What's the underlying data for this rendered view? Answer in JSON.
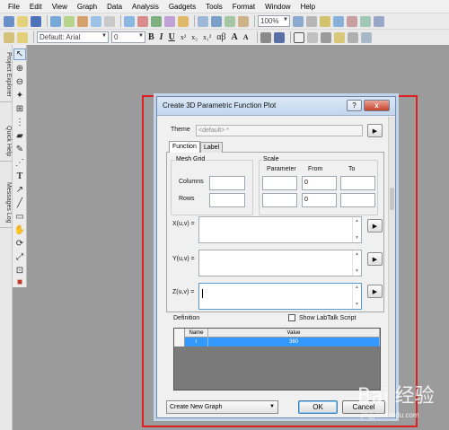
{
  "menu": [
    "File",
    "Edit",
    "View",
    "Graph",
    "Data",
    "Analysis",
    "Gadgets",
    "Tools",
    "Format",
    "Window",
    "Help"
  ],
  "toolbar": {
    "zoom_value": "100%",
    "font_name": "Default: Arial",
    "font_size": "0",
    "format_buttons": [
      "B",
      "I",
      "U",
      "x²",
      "x₂",
      "x₁²",
      "αβ",
      "A",
      "A"
    ]
  },
  "left_dock_tabs": [
    "Project Explorer",
    "Quick Help",
    "Messages Log"
  ],
  "colors": {
    "desktop": "#9b9b9b",
    "highlight_frame": "#e02020",
    "selected_row": "#3399ff"
  },
  "dialog": {
    "title": "Create 3D Parametric Function Plot",
    "help_label": "?",
    "close_label": "x",
    "theme_label": "Theme",
    "theme_value": "<default> *",
    "tabs": [
      "Function",
      "Label"
    ],
    "mesh_grid": {
      "title": "Mesh Grid",
      "columns_label": "Columns",
      "rows_label": "Rows",
      "columns_value": "",
      "rows_value": ""
    },
    "scale": {
      "title": "Scale",
      "headers": [
        "Parameter",
        "From",
        "To"
      ],
      "rows": [
        {
          "parameter": "",
          "from": "0",
          "to": ""
        },
        {
          "parameter": "",
          "from": "0",
          "to": ""
        }
      ]
    },
    "x_label": "X(u,v) =",
    "y_label": "Y(u,v) =",
    "z_label": "Z(u,v) =",
    "definition_label": "Definition",
    "show_labtalk_label": "Show LabTalk Script",
    "table": {
      "headers": [
        "Name",
        "Value"
      ],
      "rows": [
        {
          "name": "r",
          "value": "360"
        }
      ]
    },
    "dropdown_value": "Create New Graph",
    "ok_label": "OK",
    "cancel_label": "Cancel"
  },
  "watermark": {
    "text": "Bai 经验",
    "url": "jingyan.baidu.com"
  }
}
